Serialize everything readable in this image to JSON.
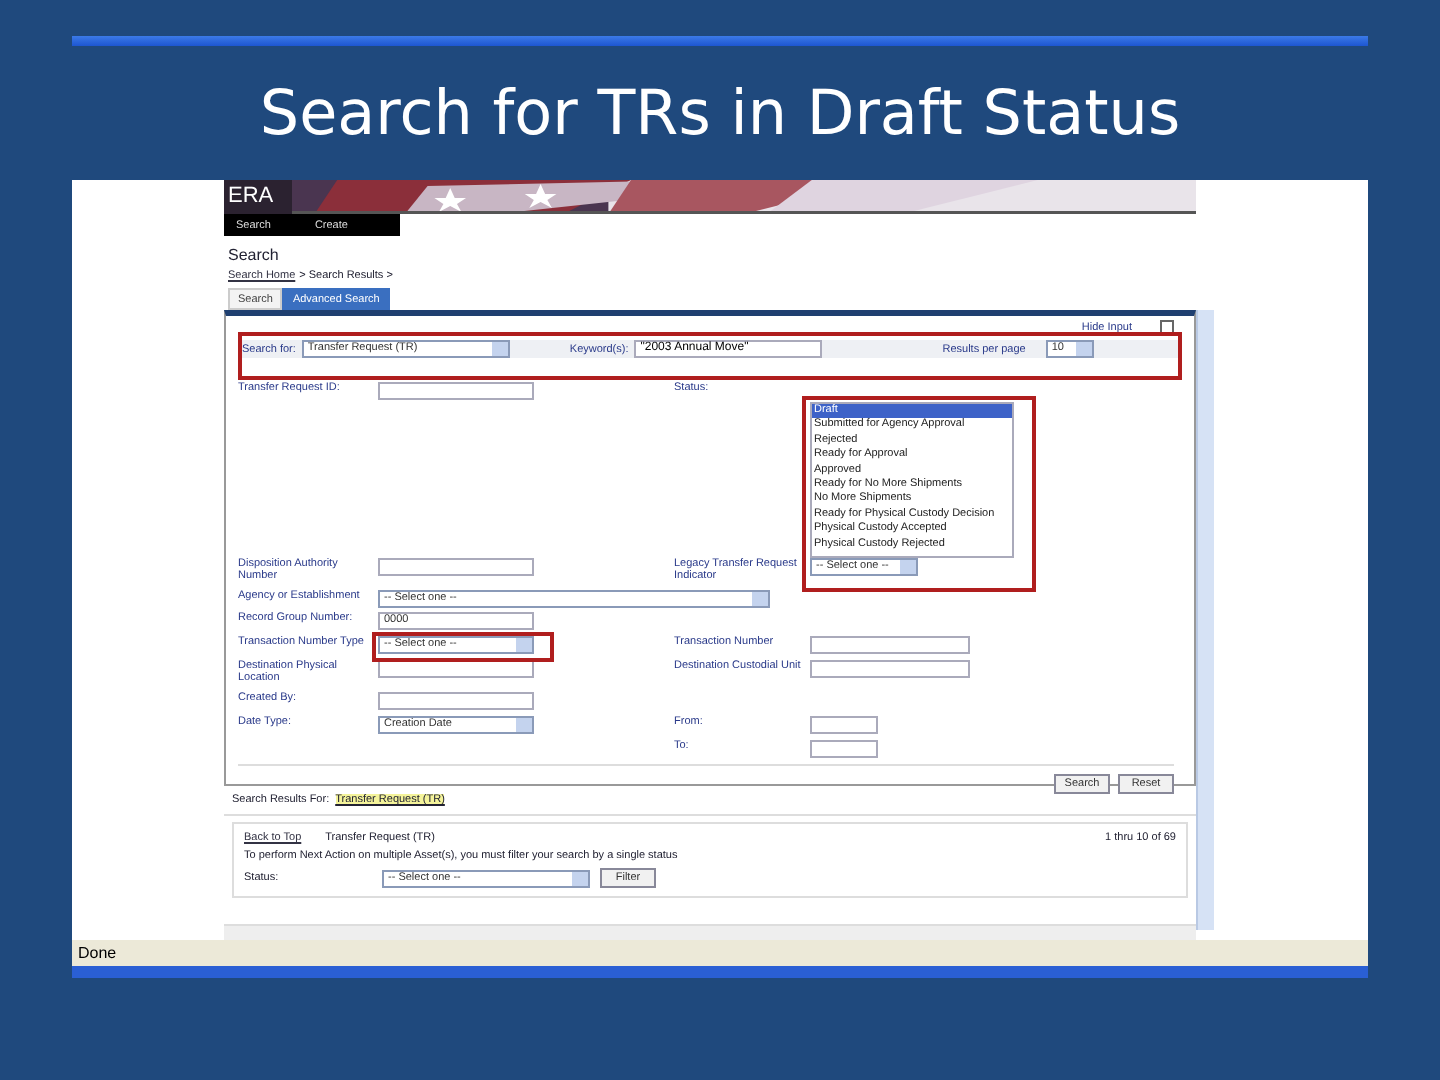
{
  "slide_title": "Search for TRs in Draft Status",
  "header": {
    "logo": "ERA",
    "nav": [
      "Search",
      "Create"
    ]
  },
  "page_title": "Search",
  "breadcrumb": {
    "link": "Search Home",
    "rest": "> Search Results >"
  },
  "tabs": [
    {
      "label": "Search",
      "selected": false
    },
    {
      "label": "Advanced Search",
      "selected": true
    }
  ],
  "hide_input": "Hide Input",
  "hide_input_checked": false,
  "search_for": {
    "label": "Search for:",
    "value": "Transfer Request (TR)"
  },
  "keywords": {
    "label": "Keyword(s):",
    "value": "\"2003 Annual Move\""
  },
  "results_per_page": {
    "label": "Results per page",
    "value": "10"
  },
  "status": {
    "label": "Status:",
    "options": [
      {
        "label": "Draft",
        "selected": true
      },
      {
        "label": "Submitted for Agency Approval",
        "selected": false
      },
      {
        "label": "Rejected",
        "selected": false
      },
      {
        "label": "Ready for Approval",
        "selected": false
      },
      {
        "label": "Approved",
        "selected": false
      },
      {
        "label": "Ready for No More Shipments",
        "selected": false
      },
      {
        "label": "No More Shipments",
        "selected": false
      },
      {
        "label": "Ready for Physical Custody Decision",
        "selected": false
      },
      {
        "label": "Physical Custody Accepted",
        "selected": false
      },
      {
        "label": "Physical Custody Rejected",
        "selected": false
      }
    ]
  },
  "fields": {
    "transfer_request_id": {
      "label": "Transfer Request ID:"
    },
    "disposition_authority": {
      "label": "Disposition Authority Number"
    },
    "legacy_indicator": {
      "label": "Legacy Transfer Request Indicator",
      "value": "-- Select one --"
    },
    "agency": {
      "label": "Agency or Establishment",
      "value": "-- Select one --"
    },
    "record_group": {
      "label": "Record Group Number:",
      "value": "0000"
    },
    "transaction_type": {
      "label": "Transaction Number Type",
      "value": "-- Select one --"
    },
    "transaction_number": {
      "label": "Transaction Number"
    },
    "destination_location": {
      "label": "Destination Physical Location"
    },
    "destination_unit": {
      "label": "Destination Custodial Unit"
    },
    "created_by": {
      "label": "Created By:"
    },
    "date_type": {
      "label": "Date Type:",
      "value": "Creation Date"
    },
    "from": {
      "label": "From:"
    },
    "to": {
      "label": "To:"
    }
  },
  "buttons": [
    "Search",
    "Reset"
  ],
  "results": {
    "label": "Search Results For:",
    "link": "Transfer Request (TR)",
    "back": "Back to Top",
    "title": "Transfer Request (TR)",
    "count": "1 thru 10 of 69",
    "note": "To perform Next Action on multiple Asset(s), you must filter your search by a single status",
    "status_label": "Status:",
    "status_value": "-- Select one --",
    "filter": "Filter"
  },
  "status_bar": "Done"
}
